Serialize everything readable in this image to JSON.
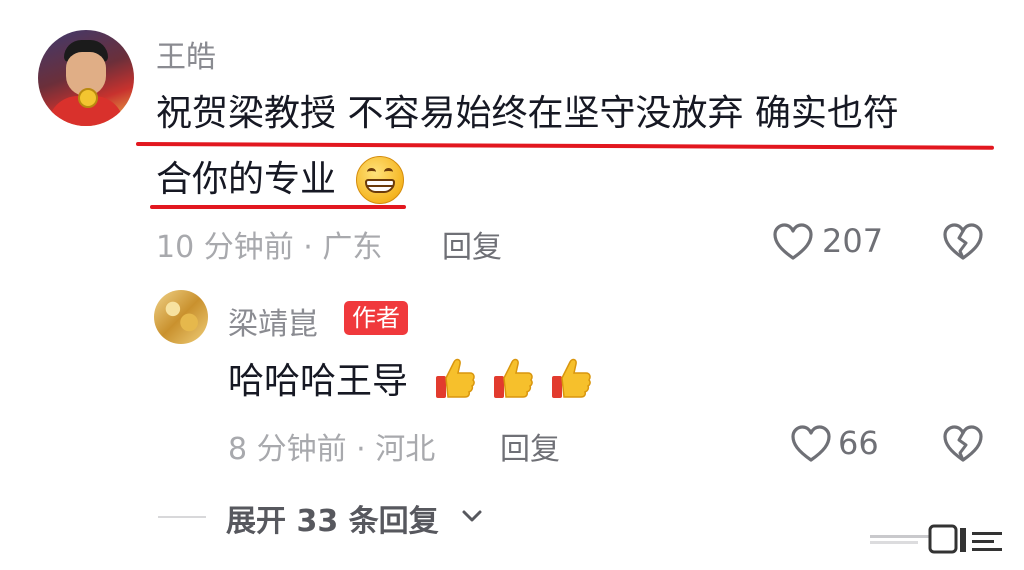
{
  "comments": [
    {
      "username": "王皓",
      "text_line1": "祝贺梁教授 不容易始终在坚守没放弃 确实也符",
      "text_line2": "合你的专业",
      "emoji": "grinning-face-emoji",
      "meta": "10 分钟前 · 广东",
      "reply_label": "回复",
      "like_count": "207"
    },
    {
      "username": "梁靖崑",
      "badge": "作者",
      "text": "哈哈哈王导",
      "emoji": "thumbs-up-emoji",
      "emoji_count": 3,
      "meta": "8 分钟前 · 河北",
      "reply_label": "回复",
      "like_count": "66"
    }
  ],
  "expand_replies": "展开 33 条回复",
  "icons": {
    "like": "heart-outline-icon",
    "dislike": "broken-heart-icon",
    "expand": "chevron-down-icon"
  },
  "colors": {
    "highlight_underline": "#e2171f",
    "author_badge": "#f0393c",
    "meta_text": "#a8a9ad"
  }
}
